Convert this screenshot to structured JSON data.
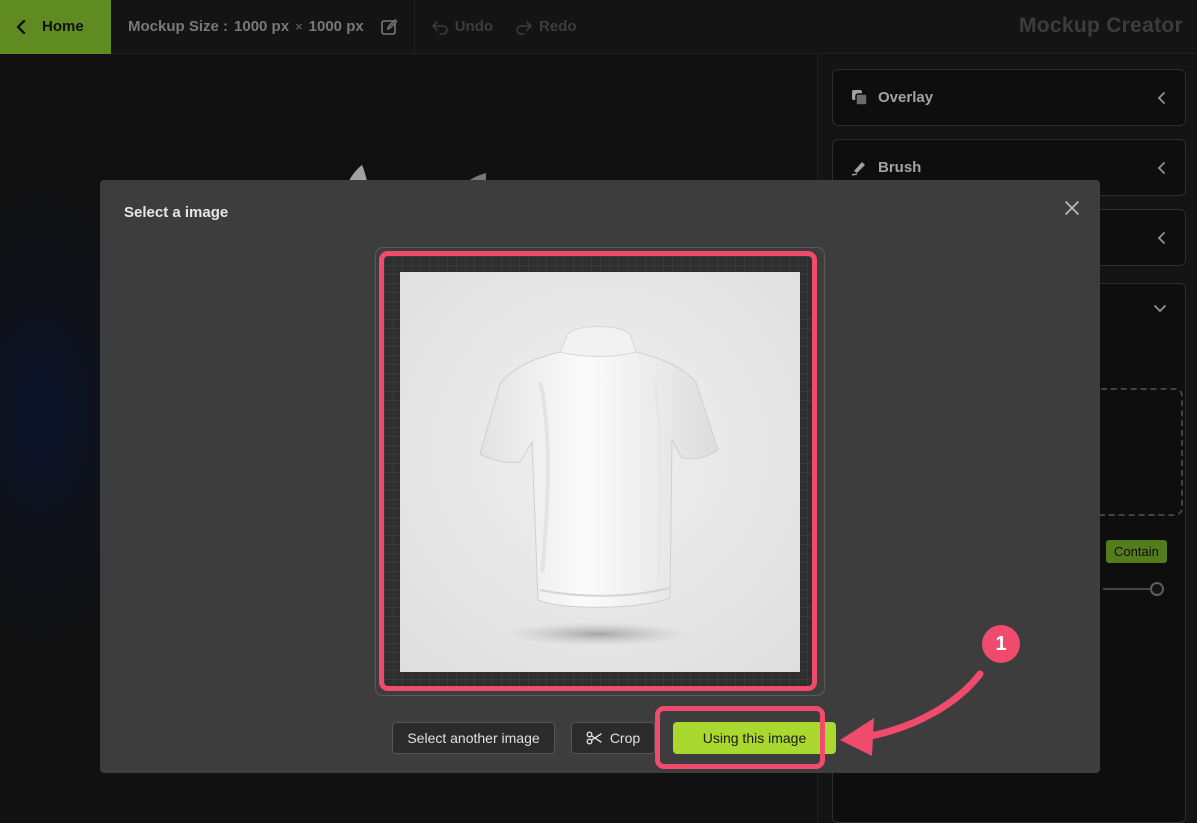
{
  "topbar": {
    "home_label": "Home",
    "size_label": "Mockup Size :",
    "width_value": "1000 px",
    "times_symbol": "×",
    "height_value": "1000 px",
    "undo_label": "Undo",
    "redo_label": "Redo",
    "app_title": "Mockup Creator"
  },
  "right_panel": {
    "accordions": [
      {
        "label": "Overlay",
        "icon": "layers-icon"
      },
      {
        "label": "Brush",
        "icon": "brush-icon"
      },
      {
        "label": "",
        "icon": ""
      }
    ],
    "contain_label": "Contain"
  },
  "modal": {
    "title": "Select a image",
    "buttons": {
      "select_another": "Select another image",
      "crop": "Crop",
      "use": "Using this image"
    }
  },
  "annotation": {
    "step_number": "1",
    "highlight_color": "#f04a6c"
  },
  "colors": {
    "accent_green": "#7bb22a",
    "primary_button": "#a9d82f"
  }
}
